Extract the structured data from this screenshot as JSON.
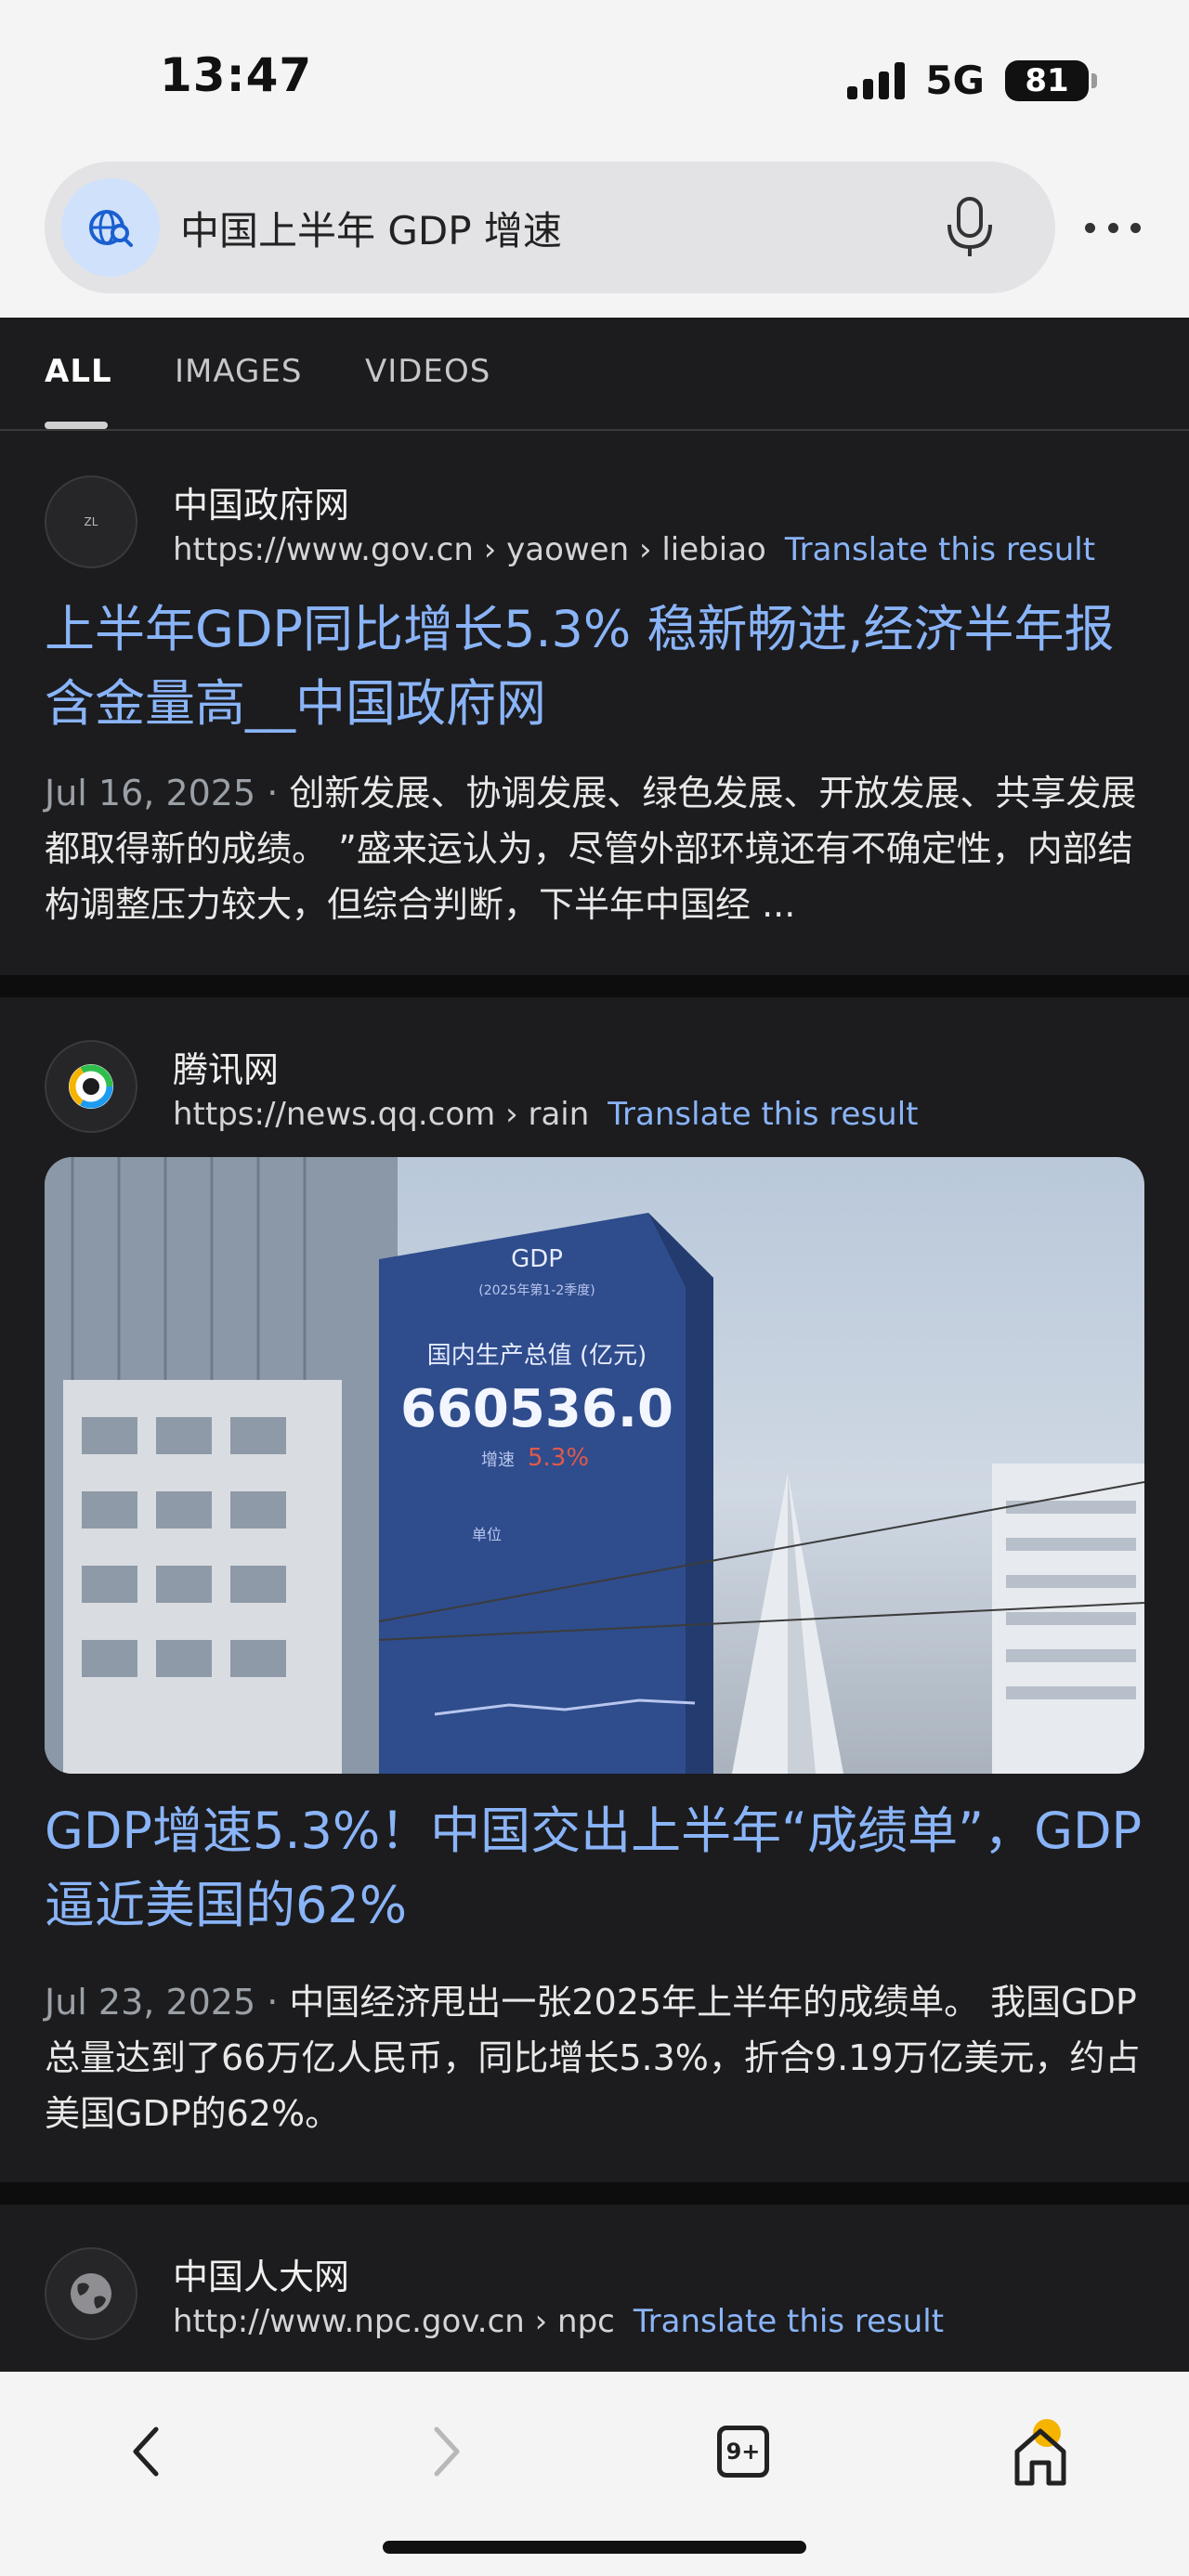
{
  "status_bar": {
    "time": "13:47",
    "network": "5G",
    "battery": "81"
  },
  "search": {
    "query": "中国上半年 GDP 增速"
  },
  "tabs": [
    {
      "label": "ALL",
      "active": true
    },
    {
      "label": "IMAGES",
      "active": false
    },
    {
      "label": "VIDEOS",
      "active": false
    }
  ],
  "results": [
    {
      "favicon_text": "ZL",
      "site": "中国政府网",
      "url": "https://www.gov.cn › yaowen › liebiao",
      "translate": "Translate this result",
      "title": "上半年GDP同比增长5.3% 稳新畅进,经济半年报含金量高__中国政府网",
      "date": "Jul 16, 2025 · ",
      "snippet": "创新发展、协调发展、绿色发展、开放发展、共享发展都取得新的成绩。 ”盛来运认为，尽管外部环境还有不确定性，内部结构调整压力较大，但综合判断，下半年中国经 ..."
    },
    {
      "site": "腾讯网",
      "url": "https://news.qq.com › rain",
      "translate": "Translate this result",
      "image": {
        "board_title": "GDP",
        "board_subtitle": "(2025年第1-2季度)",
        "board_label": "国内生产总值 (亿元)",
        "board_value": "660536.0",
        "board_rate_label": "增速",
        "board_rate": "5.3%",
        "board_other": "单位"
      },
      "title": "GDP增速5.3%！中国交出上半年“成绩单”，GDP逼近美国的62%",
      "date": "Jul 23, 2025 · ",
      "snippet": "中国经济甩出一张2025年上半年的成绩单。 我国GDP总量达到了66万亿人民币，同比增长5.3%，折合9.19万亿美元，约占美国GDP的62%。"
    },
    {
      "site": "中国人大网",
      "url": "http://www.npc.gov.cn › npc",
      "translate": "Translate this result"
    }
  ],
  "toolbar": {
    "tabs_count": "9+"
  },
  "colors": {
    "link": "#8ab4f8",
    "background": "#1c1c1e",
    "header": "#f4f4f5"
  }
}
